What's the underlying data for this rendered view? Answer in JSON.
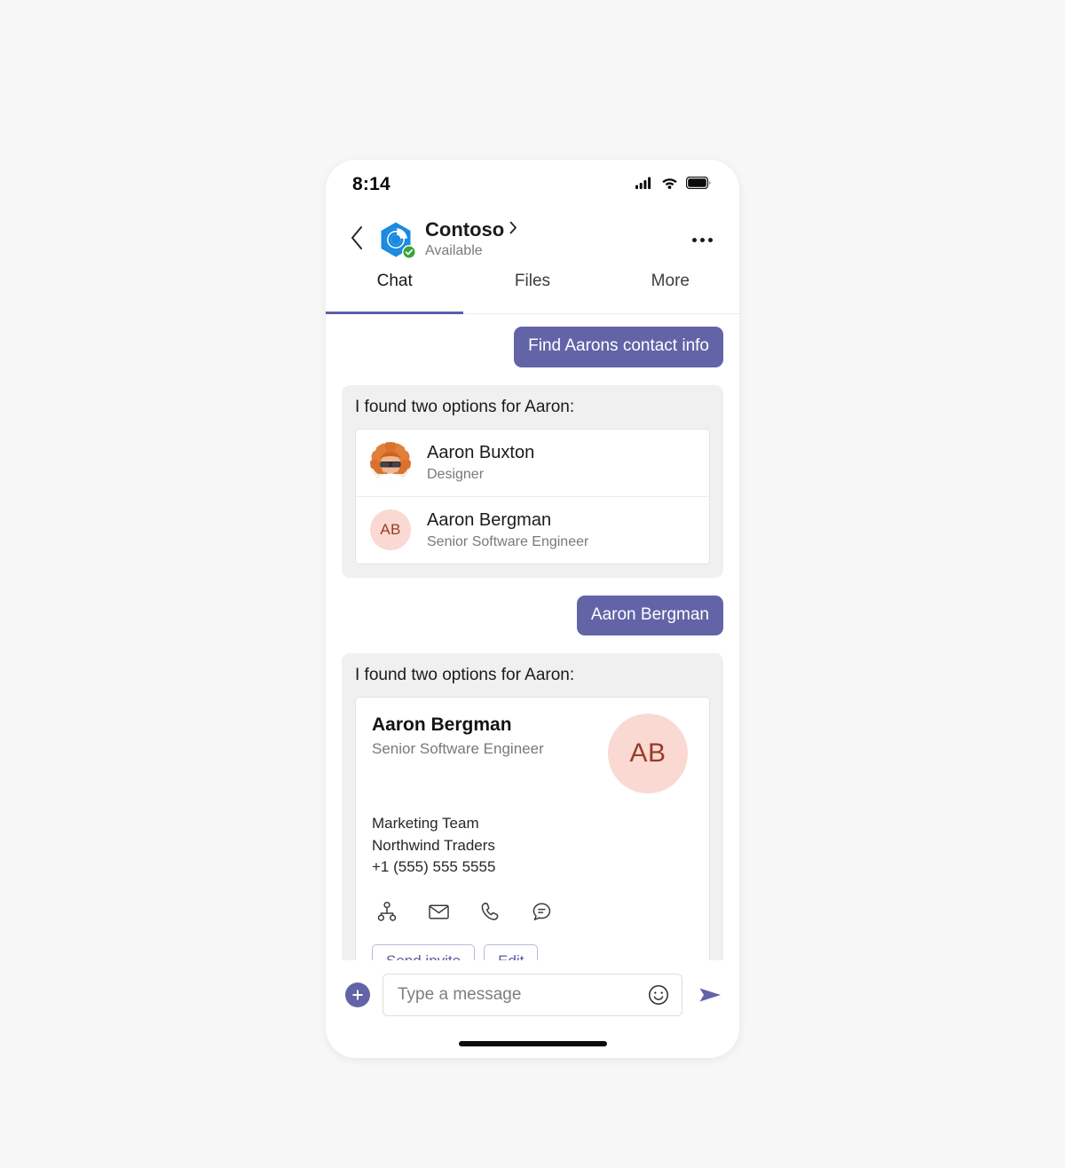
{
  "status_bar": {
    "time": "8:14",
    "signal_icon": "cellular-signal-icon",
    "wifi_icon": "wifi-icon",
    "battery_icon": "battery-icon"
  },
  "header": {
    "back_icon": "back-chevron-icon",
    "avatar_icon": "contoso-logo-icon",
    "presence_icon": "available-check-icon",
    "title": "Contoso",
    "title_chevron_icon": "chevron-right-icon",
    "subtitle": "Available",
    "overflow_icon": "more-options-icon"
  },
  "tabs": [
    {
      "label": "Chat",
      "active": true
    },
    {
      "label": "Files",
      "active": false
    },
    {
      "label": "More",
      "active": false
    }
  ],
  "conversation": [
    {
      "kind": "outgoing",
      "text": "Find Aarons contact info"
    },
    {
      "kind": "card_list",
      "lead": "I found two options for Aaron:",
      "contacts": [
        {
          "name": "Aaron Buxton",
          "title": "Designer",
          "avatar_type": "photo",
          "avatar_icon": "aaron-buxton-photo"
        },
        {
          "name": "Aaron Bergman",
          "title": "Senior Software Engineer",
          "avatar_type": "initials",
          "initials": "AB"
        }
      ]
    },
    {
      "kind": "outgoing",
      "text": "Aaron Bergman"
    },
    {
      "kind": "card_profile",
      "lead": "I found two options for Aaron:",
      "profile": {
        "name": "Aaron Bergman",
        "title": "Senior Software Engineer",
        "initials": "AB",
        "team": "Marketing Team",
        "company": "Northwind Traders",
        "phone": "+1 (555) 555 5555",
        "actions": [
          {
            "icon": "org-chart-icon"
          },
          {
            "icon": "mail-icon"
          },
          {
            "icon": "phone-icon"
          },
          {
            "icon": "chat-bubble-icon"
          }
        ],
        "buttons": [
          {
            "label": "Send invite"
          },
          {
            "label": "Edit"
          }
        ]
      }
    }
  ],
  "composer": {
    "add_icon": "plus-icon",
    "input_value": "",
    "input_placeholder": "Type a message",
    "emoji_icon": "emoji-smiley-icon",
    "send_icon": "send-arrow-icon"
  },
  "home_indicator": "home-indicator-bar",
  "colors": {
    "accent_purple": "#6264a7",
    "tab_underline": "#5b5ea6",
    "card_bg": "#f0f0f0",
    "page_bg": "#f7f7f7",
    "avatar_pink": "#f9d9d2",
    "avatar_text": "#9c3a29",
    "presence_green": "#3aa33a",
    "logo_blue": "#1a8ae0"
  }
}
